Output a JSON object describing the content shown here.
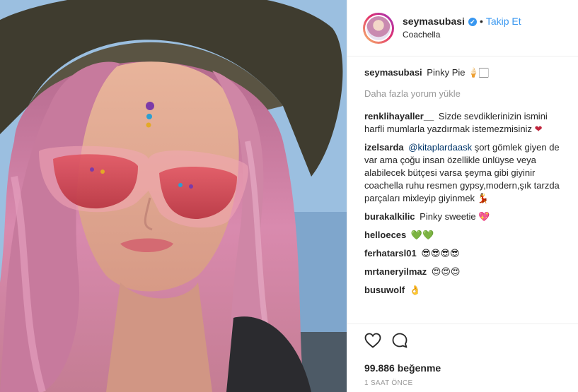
{
  "post": {
    "username": "seymasubasi",
    "verified_badge": "✔",
    "separator": "•",
    "follow_label": "Takip Et",
    "location": "Coachella"
  },
  "caption": {
    "username": "seymasubasi",
    "text": "Pinky Pie",
    "emoji": "🍦🏻"
  },
  "load_more": "Daha fazla yorum yükle",
  "comments": [
    {
      "user": "renklihayaller__",
      "text": "Sizde sevdiklerinizin ismini harfli mumlarla yazdırmak istemezmisiniz",
      "emoji": "❤"
    },
    {
      "user": "izelsarda",
      "mention": "@kitaplardaask",
      "text": "şort gömlek giyen de var ama çoğu insan özellikle ünlüyse veya alabilecek bütçesi varsa şeyma gibi giyinir coachella ruhu resmen gypsy,modern,şık tarzda parçaları mixleyip giyinmek",
      "emoji": "💃"
    },
    {
      "user": "burakalkilic",
      "text": "Pinky sweetie",
      "emoji": "💖"
    },
    {
      "user": "helloeces",
      "text": "",
      "emoji": "💚💚"
    },
    {
      "user": "ferhatarsl01",
      "text": "",
      "emoji": "😎😎😎😎"
    },
    {
      "user": "mrtaneryilmaz",
      "text": "",
      "emoji": "😍😍😍"
    },
    {
      "user": "busuwolf",
      "text": "",
      "emoji": "👌"
    }
  ],
  "likes_text": "99.886 beğenme",
  "time_text": "1 SAAT ÖNCE",
  "colors": {
    "accent": "#3897f0",
    "text": "#262626",
    "muted": "#999999",
    "hair_pink": "#d77fa8",
    "hat": "#3d3a2c"
  },
  "icons": [
    "heart-icon",
    "comment-icon",
    "verified-icon"
  ]
}
